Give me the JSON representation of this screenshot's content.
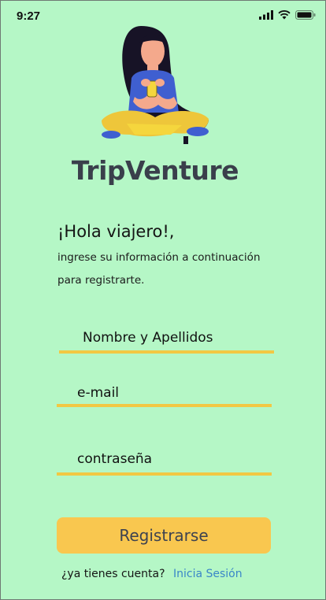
{
  "status_bar": {
    "time": "9:27"
  },
  "brand": {
    "name": "TripVenture"
  },
  "greeting": {
    "title": "¡Hola viajero!,",
    "line1": "ingrese su información a continuación",
    "line2": "para registrarte."
  },
  "form": {
    "name_placeholder": "Nombre y Apellidos",
    "email_placeholder": "e-mail",
    "password_placeholder": "contraseña",
    "submit_label": "Registrarse"
  },
  "footer": {
    "question": "¿ya tienes cuenta?",
    "link_label": "Inicia Sesión"
  },
  "colors": {
    "background": "#b5f7c6",
    "accent": "#f9c74f",
    "link": "#3a86c8",
    "brand_text": "#3a3f4b"
  }
}
